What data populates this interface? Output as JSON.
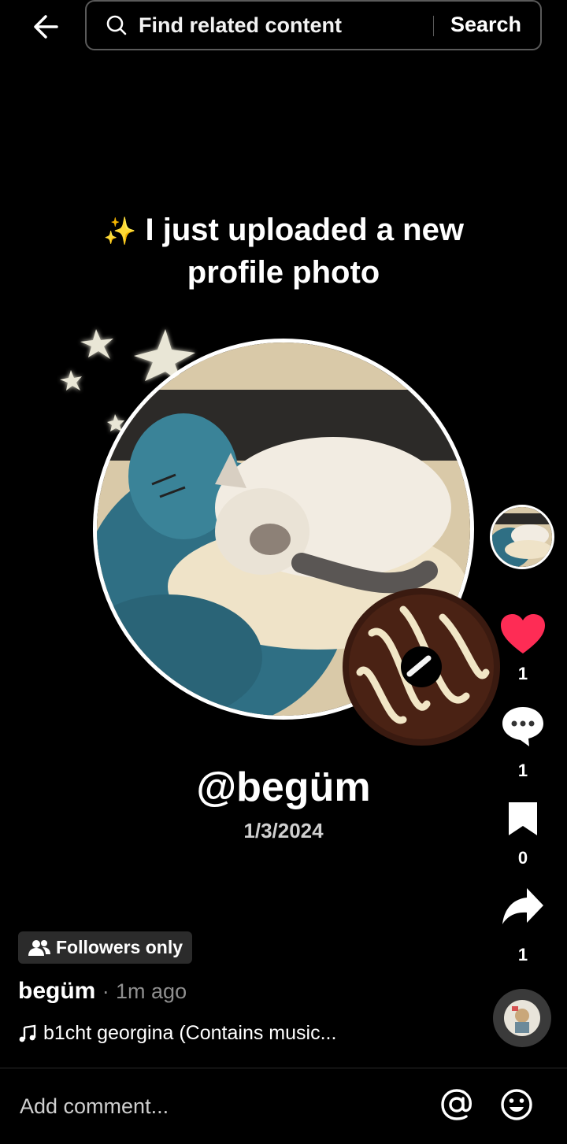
{
  "search": {
    "placeholder": "Find related content",
    "submit_label": "Search"
  },
  "video": {
    "headline_line1": "I just uploaded a new",
    "headline_line2": "profile photo",
    "handle": "@begüm",
    "date": "1/3/2024"
  },
  "actions": {
    "likes": "1",
    "comments": "1",
    "saves": "0",
    "shares": "1",
    "like_color": "#fe2c55"
  },
  "post": {
    "audience_badge": "Followers only",
    "author": "begüm",
    "separator": "·",
    "time_ago": "1m ago",
    "music": "b1cht georgina (Contains music..."
  },
  "comment": {
    "placeholder": "Add comment..."
  },
  "icons": {
    "back": "arrow-left-icon",
    "search": "magnifier-icon",
    "like": "heart-icon",
    "comment": "chat-bubble-icon",
    "save": "bookmark-icon",
    "share": "share-arrow-icon",
    "mention": "at-sign-icon",
    "emoji": "smiley-icon",
    "music": "music-note-icon",
    "audience": "people-icon"
  }
}
